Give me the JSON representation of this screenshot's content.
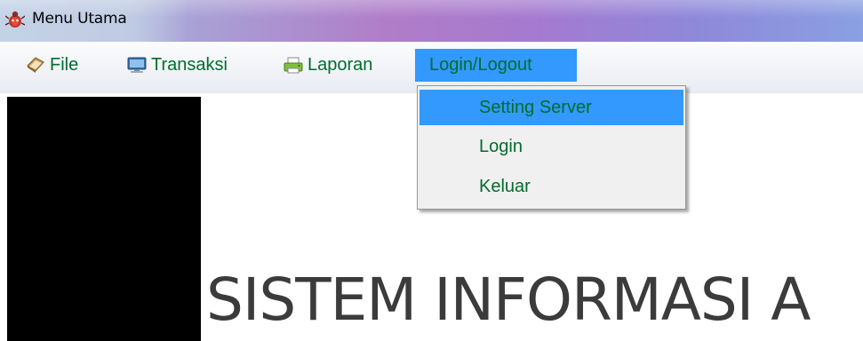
{
  "window": {
    "title": "Menu Utama",
    "icon": "app-bug-icon"
  },
  "menu_bar": {
    "items": [
      {
        "label": "File",
        "icon": "book-icon"
      },
      {
        "label": "Transaksi",
        "icon": "monitor-icon"
      },
      {
        "label": "Laporan",
        "icon": "printer-icon"
      },
      {
        "label": "Login/Logout",
        "icon": null,
        "active": true
      }
    ]
  },
  "dropdown": {
    "items": [
      {
        "label": "Setting Server",
        "highlighted": true
      },
      {
        "label": "Login"
      },
      {
        "label": "Keluar"
      }
    ]
  },
  "main": {
    "heading": "SISTEM INFORMASI A"
  },
  "colors": {
    "menu_text": "#006d2c",
    "highlight": "#3399ff",
    "menu_bar_bg": "#f1f3f7",
    "panel_black": "#000000",
    "heading_text": "#3b3b3b"
  }
}
